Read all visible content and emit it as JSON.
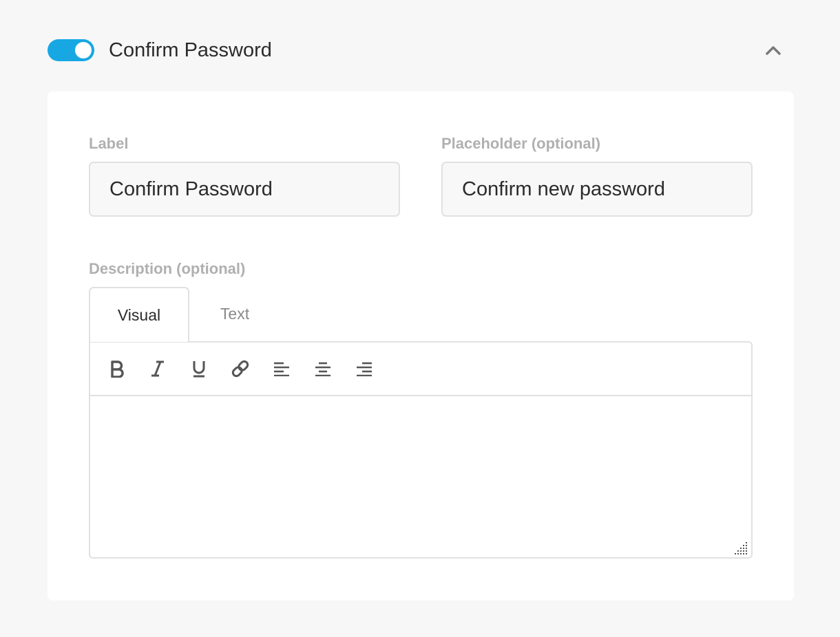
{
  "header": {
    "toggle_on": true,
    "title": "Confirm Password",
    "collapse_icon": "chevron-up-icon"
  },
  "form": {
    "label_field": {
      "label": "Label",
      "value": "Confirm Password"
    },
    "placeholder_field": {
      "label": "Placeholder (optional)",
      "value": "Confirm new password"
    },
    "description": {
      "label": "Description (optional)",
      "tabs": [
        {
          "label": "Visual",
          "active": true
        },
        {
          "label": "Text",
          "active": false
        }
      ],
      "toolbar": [
        "bold-icon",
        "italic-icon",
        "underline-icon",
        "link-icon",
        "align-left-icon",
        "align-center-icon",
        "align-right-icon"
      ],
      "content": ""
    }
  },
  "colors": {
    "accent": "#17a8e3",
    "text": "#2b2b2b",
    "muted_label": "#b0b0b0",
    "icon": "#555555"
  }
}
